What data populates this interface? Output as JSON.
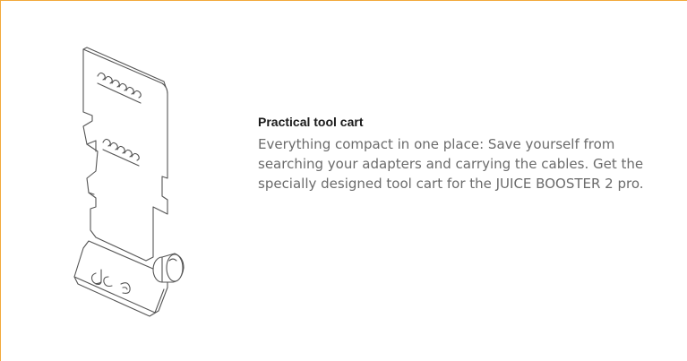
{
  "feature": {
    "title": "Practical tool cart",
    "description": "Everything compact in one place: Save yourself from searching your adapters and carrying the cables. Get the specially designed tool cart for the JUICE BOOSTER 2 pro.",
    "illustration_icon": "tool-cart-illustration",
    "accent_color": "#f2a93b"
  }
}
